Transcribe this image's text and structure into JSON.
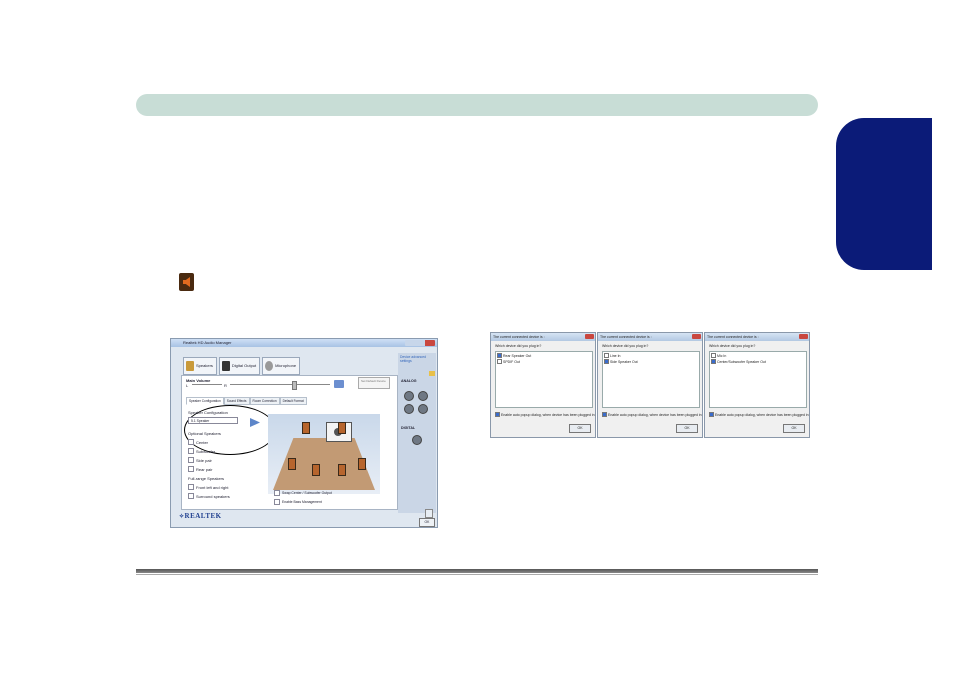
{
  "page": {
    "colors": {
      "header_bar": "#c8ddd6",
      "language_tab": "#0b1b78",
      "footer_rule": "#666666"
    }
  },
  "inline_icon": "speaker-volume-icon",
  "audio_manager": {
    "title": "Realtek HD Audio Manager",
    "device_tabs": [
      "Speakers",
      "Digital Output",
      "Microphone"
    ],
    "main_volume_label": "Main Volume",
    "balance_left": "L",
    "balance_right": "R",
    "set_default": "Set Default Device",
    "subtabs": [
      "Speaker Configuration",
      "Sound Effects",
      "Room Correction",
      "Default Format"
    ],
    "speaker_config_label": "Speaker Configuration",
    "speaker_config_value": "5.1 Speaker",
    "optional_label": "Optional Speakers",
    "optional_items": [
      "Center",
      "Subwoofer",
      "Side pair",
      "Rear pair"
    ],
    "fullrange_label": "Full-range Speakers",
    "fullrange_items": [
      "Front left and right",
      "Surround speakers"
    ],
    "bottom_options": [
      "Swap Center / Subwoofer Output",
      "Enable Bass Management"
    ],
    "advanced_link": "Device advanced settings",
    "analog_label": "ANALOG",
    "digital_label": "DIGITAL",
    "logo": "REALTEK",
    "ok": "OK"
  },
  "dialogs": [
    {
      "title": "The current connected device is :",
      "question": "Which device did you plug in?",
      "options": [
        {
          "label": "Rear Speaker Out",
          "checked": true
        },
        {
          "label": "SPDIF Out",
          "checked": false
        }
      ],
      "auto_popup": "Enable auto popup dialog, when device has been plugged in",
      "ok": "OK"
    },
    {
      "title": "The current connected device is :",
      "question": "Which device did you plug in?",
      "options": [
        {
          "label": "Line In",
          "checked": false
        },
        {
          "label": "Side Speaker Out",
          "checked": true
        }
      ],
      "auto_popup": "Enable auto popup dialog, when device has been plugged in",
      "ok": "OK"
    },
    {
      "title": "The current connected device is :",
      "question": "Which device did you plug in?",
      "options": [
        {
          "label": "Mic In",
          "checked": false
        },
        {
          "label": "Center/Subwoofer Speaker Out",
          "checked": true
        }
      ],
      "auto_popup": "Enable auto popup dialog, when device has been plugged in",
      "ok": "OK"
    }
  ]
}
